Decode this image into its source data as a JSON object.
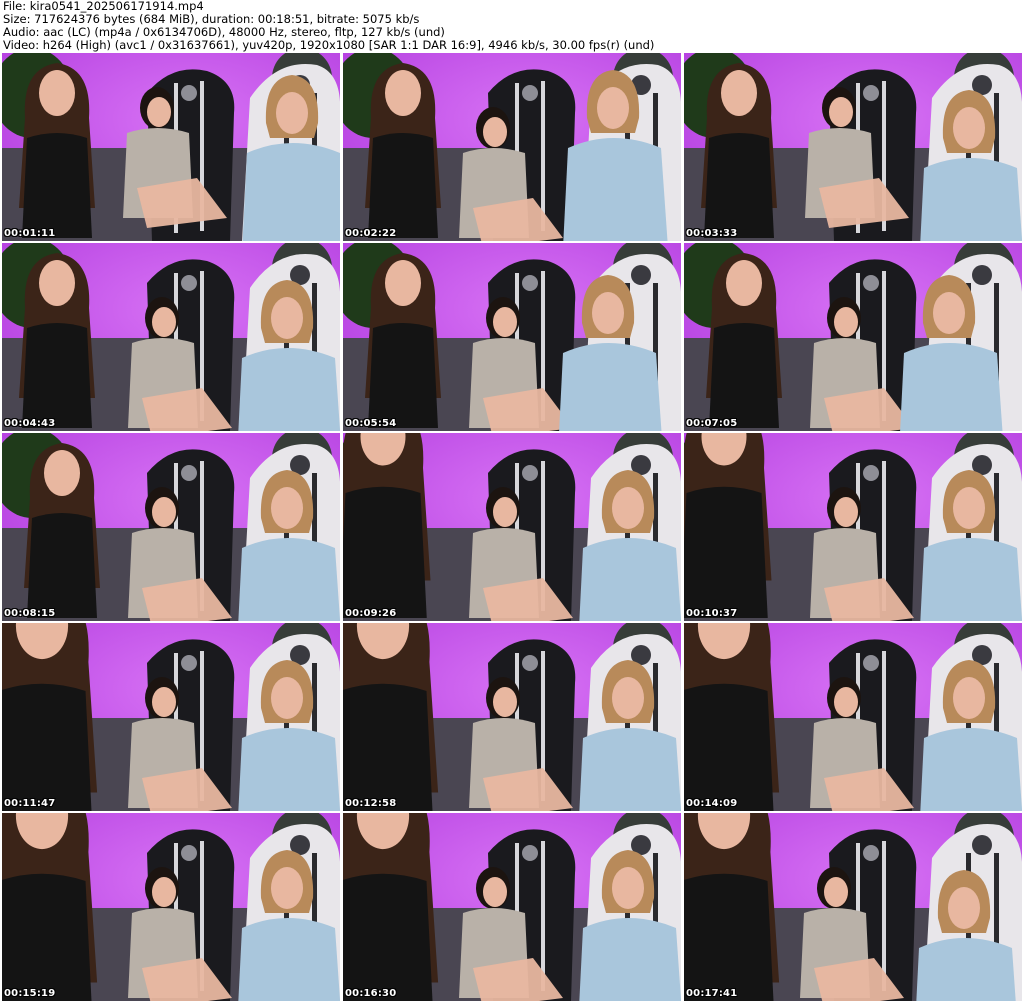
{
  "header": {
    "file": "File: kira0541_202506171914.mp4",
    "size": "Size: 717624376 bytes (684 MiB), duration: 00:18:51, bitrate: 5075 kb/s",
    "audio": "Audio: aac (LC) (mp4a / 0x6134706D), 48000 Hz, stereo, fltp, 127 kb/s (und)",
    "video": "Video: h264 (High) (avc1 / 0x31637661), yuv420p, 1920x1080 [SAR 1:1 DAR 16:9], 4946 kb/s, 30.00 fps(r) (und)"
  },
  "colors": {
    "wall": "#b43fe0",
    "wall_glow": "#d873f5",
    "plant": "#1f3a1a",
    "black_chair": "#1a1a1e",
    "white_chair": "#e8e6ea",
    "sofa": "#4a4652",
    "hair_dark": "#3b2418",
    "hair_blond": "#b88a5a",
    "skin": "#e8b7a0",
    "shirt_blue": "#a9c6dc",
    "sweater_grey": "#b9b1a8"
  },
  "thumbnails": [
    {
      "time": "00:01:11"
    },
    {
      "time": "00:02:22"
    },
    {
      "time": "00:03:33"
    },
    {
      "time": "00:04:43"
    },
    {
      "time": "00:05:54"
    },
    {
      "time": "00:07:05"
    },
    {
      "time": "00:08:15"
    },
    {
      "time": "00:09:26"
    },
    {
      "time": "00:10:37"
    },
    {
      "time": "00:11:47"
    },
    {
      "time": "00:12:58"
    },
    {
      "time": "00:14:09"
    },
    {
      "time": "00:15:19"
    },
    {
      "time": "00:16:30"
    },
    {
      "time": "00:17:41"
    }
  ]
}
